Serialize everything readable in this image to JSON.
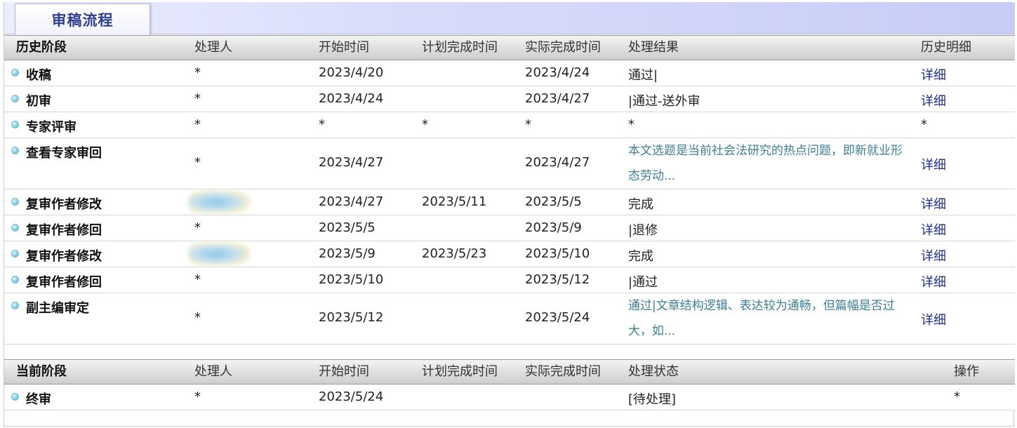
{
  "tab": {
    "label": "审稿流程"
  },
  "history": {
    "headers": [
      "历史阶段",
      "处理人",
      "开始时间",
      "计划完成时间",
      "实际完成时间",
      "处理结果",
      "历史明细"
    ],
    "rows": [
      {
        "stage": "收稿",
        "handler": "*",
        "start": "2023/4/20",
        "planned": "",
        "actual": "2023/4/24",
        "result": "通过|",
        "detail": "详细"
      },
      {
        "stage": "初审",
        "handler": "*",
        "start": "2023/4/24",
        "planned": "",
        "actual": "2023/4/27",
        "result": "|通过-送外审",
        "detail": "详细"
      },
      {
        "stage": "专家评审",
        "handler": "*",
        "start": "*",
        "planned": "*",
        "actual": "*",
        "result": "*",
        "detail": "*"
      },
      {
        "stage": "查看专家审回",
        "handler": "*",
        "start": "2023/4/27",
        "planned": "",
        "actual": "2023/4/27",
        "result": "本文选题是当前社会法研究的热点问题，即新就业形态劳动...",
        "detail": "详细"
      },
      {
        "stage": "复审作者修改",
        "handler": "",
        "start": "2023/4/27",
        "planned": "2023/5/11",
        "actual": "2023/5/5",
        "result": "完成",
        "detail": "详细"
      },
      {
        "stage": "复审作者修回",
        "handler": "*",
        "start": "2023/5/5",
        "planned": "",
        "actual": "2023/5/9",
        "result": "|退修",
        "detail": "详细"
      },
      {
        "stage": "复审作者修改",
        "handler": "",
        "start": "2023/5/9",
        "planned": "2023/5/23",
        "actual": "2023/5/10",
        "result": "完成",
        "detail": "详细"
      },
      {
        "stage": "复审作者修回",
        "handler": "*",
        "start": "2023/5/10",
        "planned": "",
        "actual": "2023/5/12",
        "result": "|通过",
        "detail": "详细"
      },
      {
        "stage": "副主编审定",
        "handler": "*",
        "start": "2023/5/12",
        "planned": "",
        "actual": "2023/5/24",
        "result": "通过|文章结构逻辑、表达较为通畅，但篇幅是否过大，如...",
        "detail": "详细"
      }
    ]
  },
  "current": {
    "headers": [
      "当前阶段",
      "处理人",
      "开始时间",
      "计划完成时间",
      "实际完成时间",
      "处理状态",
      "操作"
    ],
    "rows": [
      {
        "stage": "终审",
        "handler": "*",
        "start": "2023/5/24",
        "planned": "",
        "actual": "",
        "status": "[待处理]",
        "action": "*"
      }
    ]
  }
}
